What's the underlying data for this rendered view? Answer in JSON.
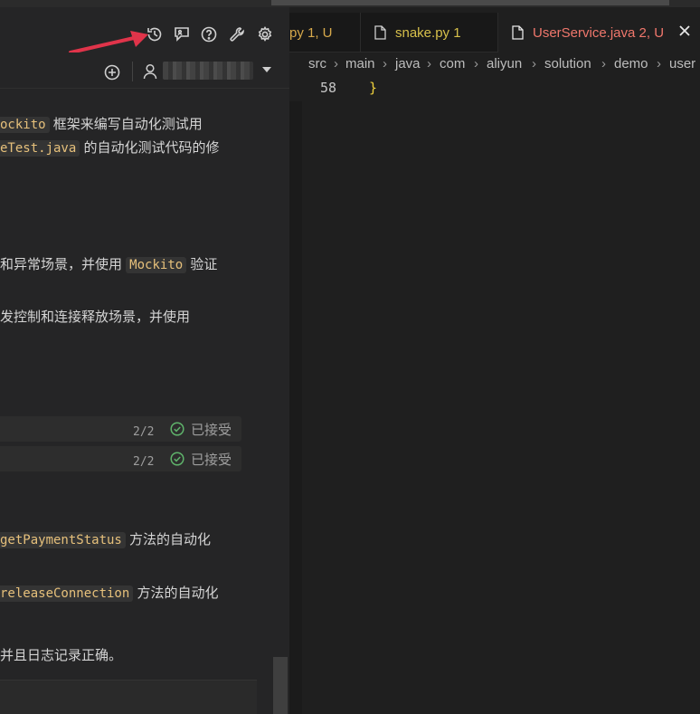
{
  "toolbar": {
    "icons": [
      "history-icon",
      "feedback-icon",
      "help-icon",
      "wrench-icon",
      "gear-icon"
    ]
  },
  "account": {
    "add_icon": "add-circle-icon",
    "user_icon": "person-icon",
    "name": "",
    "dropdown_icon": "caret-down-icon"
  },
  "chat": {
    "line1_code": "ockito",
    "line1_text": " 框架来编写自动化测试用",
    "line2_code": "eTest.java",
    "line2_text": " 的自动化测试代码的修",
    "line3_text": "和异常场景，并使用 ",
    "line3_code": "Mockito",
    "line3_tail": " 验证",
    "line4_text": "发控制和连接释放场景，并使用",
    "status_rows": [
      {
        "count": "2/2",
        "label": "已接受"
      },
      {
        "count": "2/2",
        "label": "已接受"
      }
    ],
    "line5_code": "getPaymentStatus",
    "line5_text": " 方法的自动化",
    "line6_code": "releaseConnection",
    "line6_text": " 方法的自动化",
    "line7_text": "并且日志记录正确。"
  },
  "tabs": [
    {
      "label": "py 1, U",
      "color": "#d7a94b"
    },
    {
      "label": "snake.py 1",
      "color": "#d7c04b"
    },
    {
      "label": "UserService.java 2, U",
      "color": "#f0776c",
      "active": true
    }
  ],
  "breadcrumb": [
    "src",
    "main",
    "java",
    "com",
    "aliyun",
    "solution",
    "demo",
    "user"
  ],
  "editor": {
    "line_number": "58",
    "code": "}"
  },
  "colors": {
    "accent_red": "#f0776c",
    "accent_yellow": "#d7c04b",
    "accept_green": "#5fb36b"
  }
}
